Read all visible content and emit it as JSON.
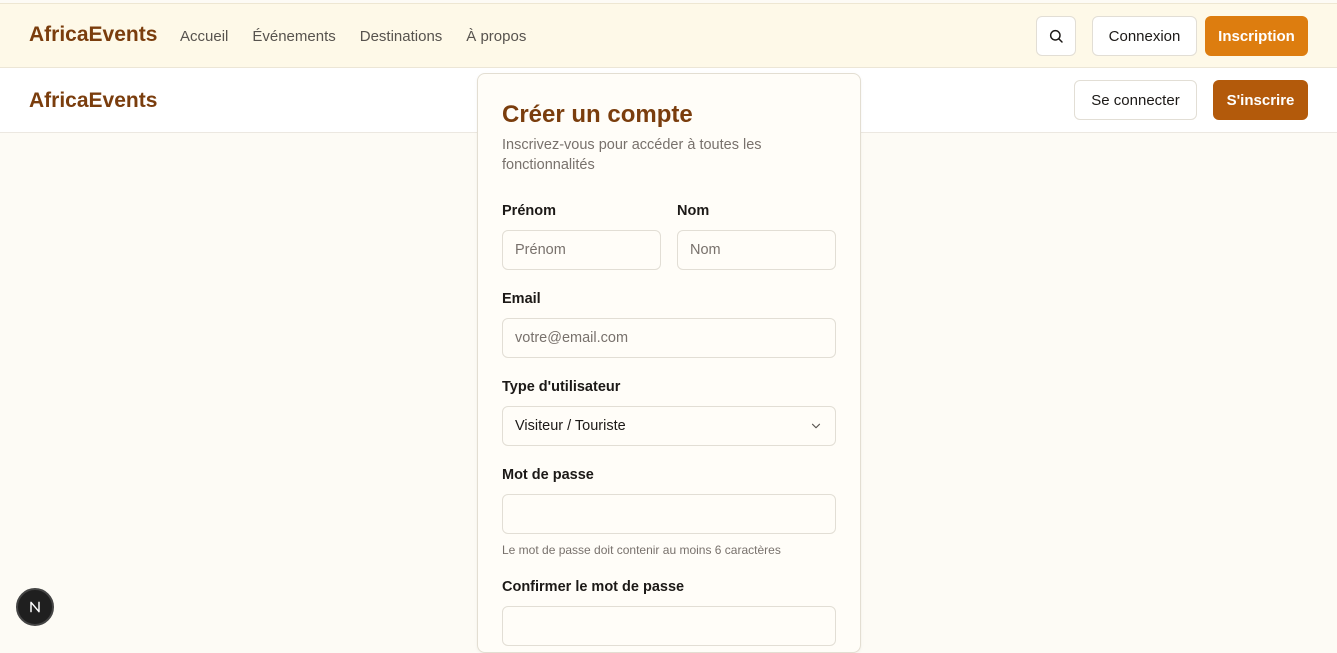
{
  "header": {
    "brand": "AfricaEvents",
    "nav": [
      "Accueil",
      "Événements",
      "Destinations",
      "À propos"
    ],
    "search_icon": "search-icon",
    "login_label": "Connexion",
    "signup_label": "Inscription"
  },
  "subheader": {
    "brand": "AfricaEvents",
    "login_label": "Se connecter",
    "signup_label": "S'inscrire"
  },
  "form": {
    "title": "Créer un compte",
    "subtitle": "Inscrivez-vous pour accéder à toutes les fonctionnalités",
    "first_name": {
      "label": "Prénom",
      "placeholder": "Prénom",
      "value": ""
    },
    "last_name": {
      "label": "Nom",
      "placeholder": "Nom",
      "value": ""
    },
    "email": {
      "label": "Email",
      "placeholder": "votre@email.com",
      "value": ""
    },
    "user_type": {
      "label": "Type d'utilisateur",
      "value": "Visiteur / Touriste"
    },
    "password": {
      "label": "Mot de passe",
      "hint": "Le mot de passe doit contenir au moins 6 caractères",
      "value": ""
    },
    "confirm_password": {
      "label": "Confirmer le mot de passe",
      "value": ""
    }
  },
  "colors": {
    "brand": "#7a3d0d",
    "primary": "#dd7d0f",
    "primary_dark": "#b35a0b",
    "background": "#fdfbf5"
  }
}
